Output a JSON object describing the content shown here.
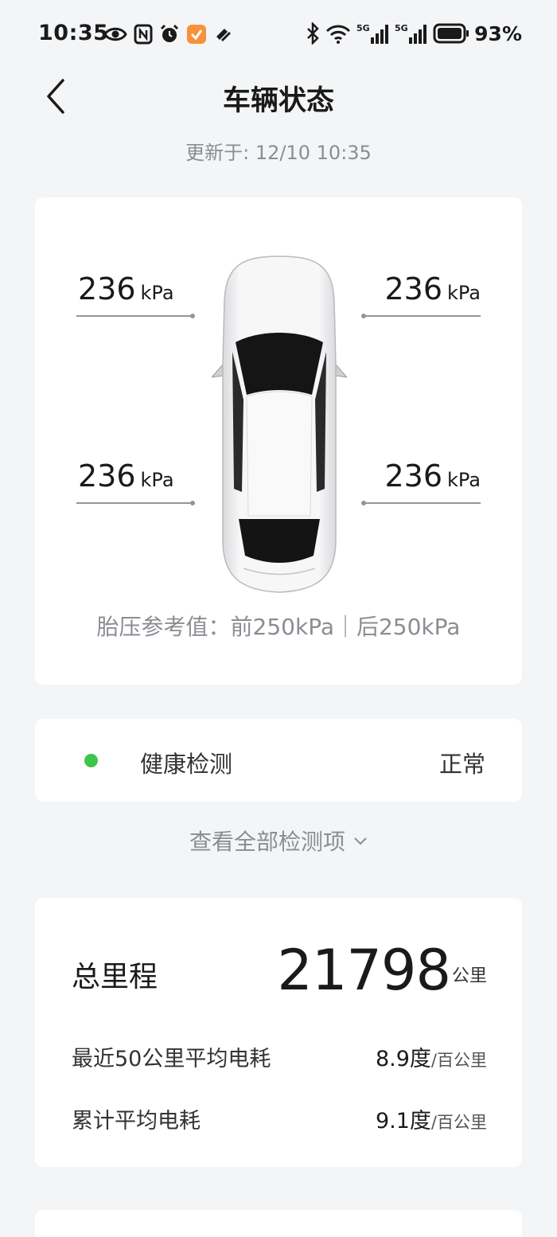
{
  "status_bar": {
    "time": "10:35",
    "battery_percent": "93%",
    "left_icons": [
      "eye-icon",
      "nfc-icon",
      "alarm-icon",
      "app-badge-icon",
      "app-icon"
    ],
    "right_icons": [
      "bluetooth-icon",
      "wifi-icon",
      "signal-5g-icon",
      "signal-5g-icon",
      "battery-icon"
    ]
  },
  "header": {
    "title": "车辆状态",
    "update_time": "更新于: 12/10 10:35"
  },
  "tires": {
    "front_left": {
      "value": "236",
      "unit": "kPa"
    },
    "front_right": {
      "value": "236",
      "unit": "kPa"
    },
    "rear_left": {
      "value": "236",
      "unit": "kPa"
    },
    "rear_right": {
      "value": "236",
      "unit": "kPa"
    },
    "reference": "胎压参考值：前250kPa｜后250kPa"
  },
  "health": {
    "label": "健康检测",
    "status": "正常",
    "status_color": "#3ec64a"
  },
  "view_all": "查看全部检测项",
  "mileage": {
    "label": "总里程",
    "value": "21798",
    "unit": "公里",
    "recent_label": "最近50公里平均电耗",
    "recent_value": "8.9度",
    "recent_unit": "/百公里",
    "total_label": "累计平均电耗",
    "total_value": "9.1度",
    "total_unit": "/百公里"
  }
}
